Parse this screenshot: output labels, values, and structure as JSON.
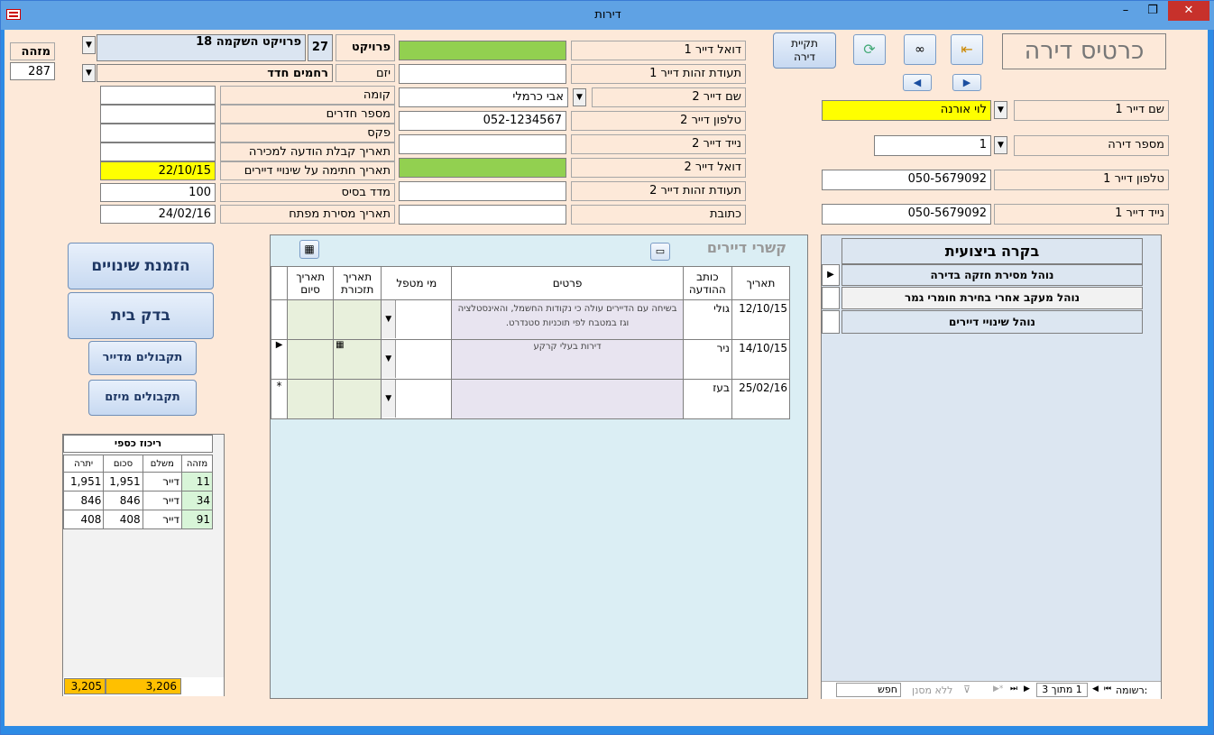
{
  "window": {
    "title": "דירות",
    "min": "–",
    "restore": "❐",
    "close": "✕",
    "app_icon": "form-icon"
  },
  "header": {
    "title": "כרטיס דירה",
    "folder_btn": "תקיית\nדירה"
  },
  "right_fields": {
    "tenant1_name_label": "שם דייר 1",
    "tenant1_name": "לוי אורנה",
    "apt_no_label": "מספר דירה",
    "apt_no": "1",
    "tenant1_phone_label": "טלפון דייר 1",
    "tenant1_phone": "050-5679092",
    "tenant1_mobile_label": "נייד דייר 1",
    "tenant1_mobile": "050-5679092"
  },
  "mid_fields": {
    "email1_label": "דואל דייר 1",
    "id1_label": "תעודת זהות דייר 1",
    "tenant2_name_label": "שם דייר 2",
    "tenant2_name": "אבי כרמלי",
    "phone2_label": "טלפון דייר 2",
    "phone2": "052-1234567",
    "mobile2_label": "נייד דייר 2",
    "email2_label": "דואל דייר 2",
    "id2_label": "תעודת זהות דייר 2",
    "address_label": "כתובת"
  },
  "left_fields": {
    "id_label": "מזהה",
    "id_value": "287",
    "project_label": "פרויקט",
    "project_no": "27",
    "project_name": "פרויקט השקמה 18",
    "developer_label": "יזם",
    "developer": "רחמים חדד",
    "floor_label": "קומה",
    "rooms_label": "מספר חדרים",
    "fax_label": "פקס",
    "sale_notice_label": "תאריך קבלת הודעה למכירה",
    "sign_changes_label": "תאריך חתימה על שינויי דיירים",
    "sign_changes": "22/10/15",
    "base_index_label": "מדד בסיס",
    "base_index": "100",
    "key_delivery_label": "תאריך מסירת מפתח",
    "key_delivery": "24/02/16"
  },
  "side_buttons": {
    "order_changes": "הזמנת שינויים",
    "check_house": "בדק בית",
    "tenant_receipts": "תקבולים מדייר",
    "developer_receipts": "תקבולים מיזם"
  },
  "finance": {
    "title": "ריכוז כספי",
    "headers": [
      "מזהה",
      "משלם",
      "סכום",
      "יתרה"
    ],
    "rows": [
      {
        "id": "11",
        "payer": "דייר",
        "amount": "1,951",
        "balance": "1,951"
      },
      {
        "id": "34",
        "payer": "דייר",
        "amount": "846",
        "balance": "846"
      },
      {
        "id": "91",
        "payer": "דייר",
        "amount": "408",
        "balance": "408"
      }
    ],
    "total_amount": "3,206",
    "total_balance": "3,205"
  },
  "contacts": {
    "title": "קשרי דיירים",
    "headers": {
      "date": "תאריך",
      "writer": "כותב\nההודעה",
      "details": "פרטים",
      "handler": "מי מטפל",
      "reminder": "תאריך\nתזכורת",
      "end": "תאריך\nסיום"
    },
    "rows": [
      {
        "date": "12/10/15",
        "writer": "גולי",
        "details": "בשיחה עם הדיירים עולה כי נקודות החשמל, והאינסטלציה וגז במטבח לפי תוכניות סטנדרט."
      },
      {
        "date": "14/10/15",
        "writer": "ניר",
        "details": "דירות בעלי קרקע"
      },
      {
        "date": "25/02/16",
        "writer": "בעז",
        "details": ""
      }
    ]
  },
  "inspection": {
    "title": "בקרה ביצועית",
    "items": [
      "נוהל מסירת חזקה בדירה",
      "נוהל מעקב אחרי בחירת חומרי גמר",
      "נוהל שינויי דיירים"
    ],
    "nav": {
      "record_label": "רשומה:",
      "current": "1 מתוך 3",
      "no_filter": "ללא מסנן",
      "search": "חפש"
    }
  }
}
